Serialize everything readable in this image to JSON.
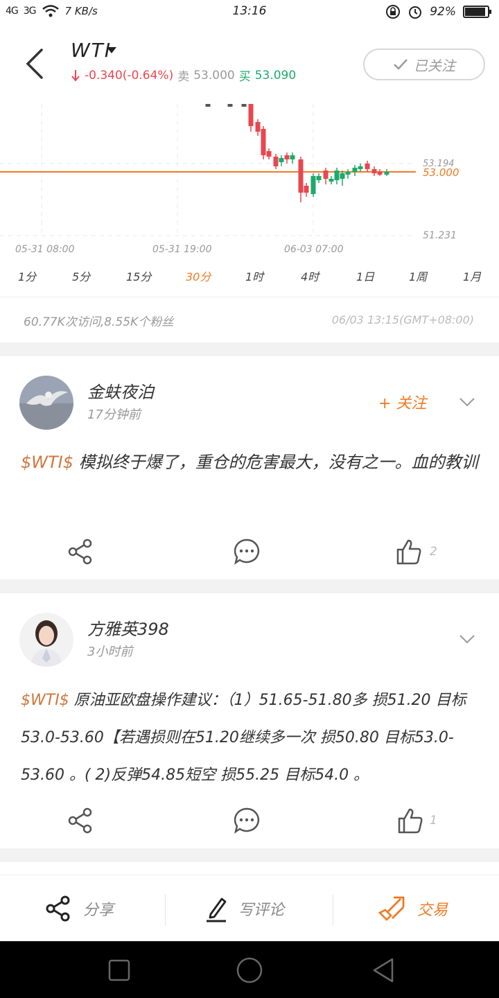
{
  "status": {
    "net1": "4G",
    "net2": "3G",
    "speed": "7 KB/s",
    "time": "13:16",
    "battery": "92%",
    "battery_level": 0.92
  },
  "header": {
    "title": "WTI",
    "change": "-0.340(-0.64%)",
    "sell_label": "卖",
    "sell_price": "53.000",
    "buy_label": "买",
    "buy_price": "53.090",
    "follow_label": "已关注"
  },
  "chart": {
    "price_high": "53.194",
    "price_current": "53.000",
    "price_low": "51.231",
    "time_labels": [
      "05-31 08:00",
      "05-31 19:00",
      "06-03 07:00"
    ],
    "periods": [
      "1分",
      "5分",
      "15分",
      "30分",
      "1时",
      "4时",
      "1日",
      "1周",
      "1月"
    ],
    "active_period": "30分",
    "colors": {
      "up": "#1daa6b",
      "down": "#e8474f",
      "line": "#f07a22"
    }
  },
  "stats": {
    "visits_fans": "60.77K次访问,8.55K个粉丝",
    "updated": "06/03 13:15(GMT+08:00)"
  },
  "posts": [
    {
      "author": "金蚨夜泊",
      "ago": "17分钟前",
      "follow": "+ 关注",
      "tag": "$WTI$",
      "text": " 模拟终于爆了，重仓的危害最大，没有之一。血的教训",
      "likes": "2"
    },
    {
      "author": "方雅英398",
      "ago": "3小时前",
      "tag": "$WTI$",
      "text": " 原油亚欧盘操作建议：（1）51.65-51.80多 损51.20 目标53.0-53.60【若遇损则在51.20继续多一次 损50.80 目标53.0-53.60 。( 2)反弹54.85短空 损55.25 目标54.0 。",
      "likes": "1"
    }
  ],
  "bottom": {
    "share": "分享",
    "comment": "写评论",
    "trade": "交易"
  }
}
